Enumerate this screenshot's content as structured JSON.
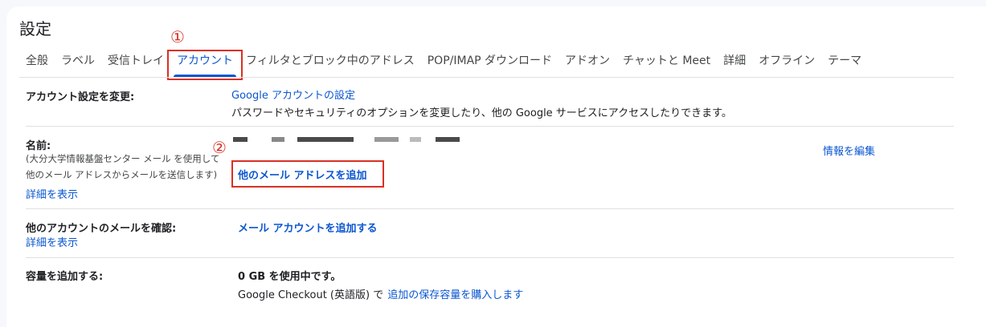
{
  "page": {
    "title": "設定"
  },
  "tabs": [
    {
      "label": "全般"
    },
    {
      "label": "ラベル"
    },
    {
      "label": "受信トレイ"
    },
    {
      "label": "アカウント"
    },
    {
      "label": "フィルタとブロック中のアドレス"
    },
    {
      "label": "POP/IMAP ダウンロード"
    },
    {
      "label": "アドオン"
    },
    {
      "label": "チャットと Meet"
    },
    {
      "label": "詳細"
    },
    {
      "label": "オフライン"
    },
    {
      "label": "テーマ"
    }
  ],
  "annotations": {
    "marker1": "①",
    "marker2": "②",
    "accent": "#d93025"
  },
  "sections": {
    "account": {
      "label": "アカウント設定を変更:",
      "link": "Google アカウントの設定",
      "description": "パスワードやセキュリティのオプションを変更したり、他の Google サービスにアクセスしたりできます。"
    },
    "name": {
      "label": "名前:",
      "sub1": "(大分大学情報基盤センター メール を使用して",
      "sub2": "他のメール アドレスからメールを送信します)",
      "details": "詳細を表示",
      "add_address": "他のメール アドレスを追加",
      "edit": "情報を編集"
    },
    "check_mail": {
      "label": "他のアカウントのメールを確認:",
      "details": "詳細を表示",
      "add_account": "メール アカウントを追加する"
    },
    "storage": {
      "label": "容量を追加する:",
      "usage": "0 GB を使用中です。",
      "checkout": "Google Checkout (英語版) で",
      "buy_link": "追加の保存容量を購入します"
    }
  }
}
